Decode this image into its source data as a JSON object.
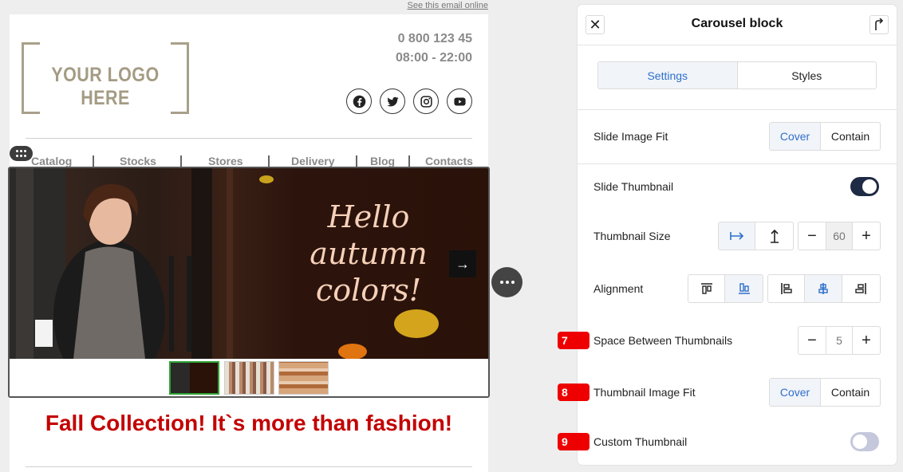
{
  "email": {
    "see_online": "See this email online",
    "logo_text": "YOUR LOGO HERE",
    "phone": "0 800 123 45",
    "hours": "08:00 - 22:00",
    "social_icons": [
      "facebook-icon",
      "twitter-icon",
      "instagram-icon",
      "youtube-icon"
    ],
    "nav": [
      "Catalog",
      "Stocks",
      "Stores",
      "Delivery",
      "Blog",
      "Contacts"
    ],
    "slide_text": [
      "Hello",
      "autumn",
      "colors!"
    ],
    "thumbnails": 3,
    "active_thumbnail": 1,
    "headline": "Fall Collection! It`s more than fashion!",
    "headline_color": "#c30000"
  },
  "panel": {
    "title": "Carousel block",
    "tabs": [
      "Settings",
      "Styles"
    ],
    "active_tab": "Settings",
    "slide_image_fit": {
      "label": "Slide Image Fit",
      "options": [
        "Cover",
        "Contain"
      ],
      "selected": "Cover"
    },
    "slide_thumbnail": {
      "label": "Slide Thumbnail",
      "enabled": true
    },
    "thumbnail_size": {
      "label": "Thumbnail Size",
      "value": "60",
      "minus": "−",
      "plus": "+",
      "modes": [
        "width-icon",
        "height-icon"
      ],
      "selected_mode": "width-icon"
    },
    "alignment": {
      "label": "Alignment",
      "vertical": [
        "align-top-icon",
        "align-bottom-icon"
      ],
      "vertical_selected": "align-bottom-icon",
      "horizontal": [
        "align-left-icon",
        "align-center-icon",
        "align-right-icon"
      ],
      "horizontal_selected": "align-center-icon"
    },
    "space_between": {
      "label": "Space Between Thumbnails",
      "value": "5",
      "minus": "−",
      "plus": "+"
    },
    "thumbnail_image_fit": {
      "label": "Thumbnail Image Fit",
      "options": [
        "Cover",
        "Contain"
      ],
      "selected": "Cover"
    },
    "custom_thumbnail": {
      "label": "Custom Thumbnail",
      "enabled": false
    },
    "accent_color": "#2f6fcc",
    "toggle_on_color": "#1f2a44",
    "toggle_off_color": "#c5c8dc"
  },
  "badges": [
    "7",
    "8",
    "9"
  ],
  "badge_color": "#ee0000"
}
